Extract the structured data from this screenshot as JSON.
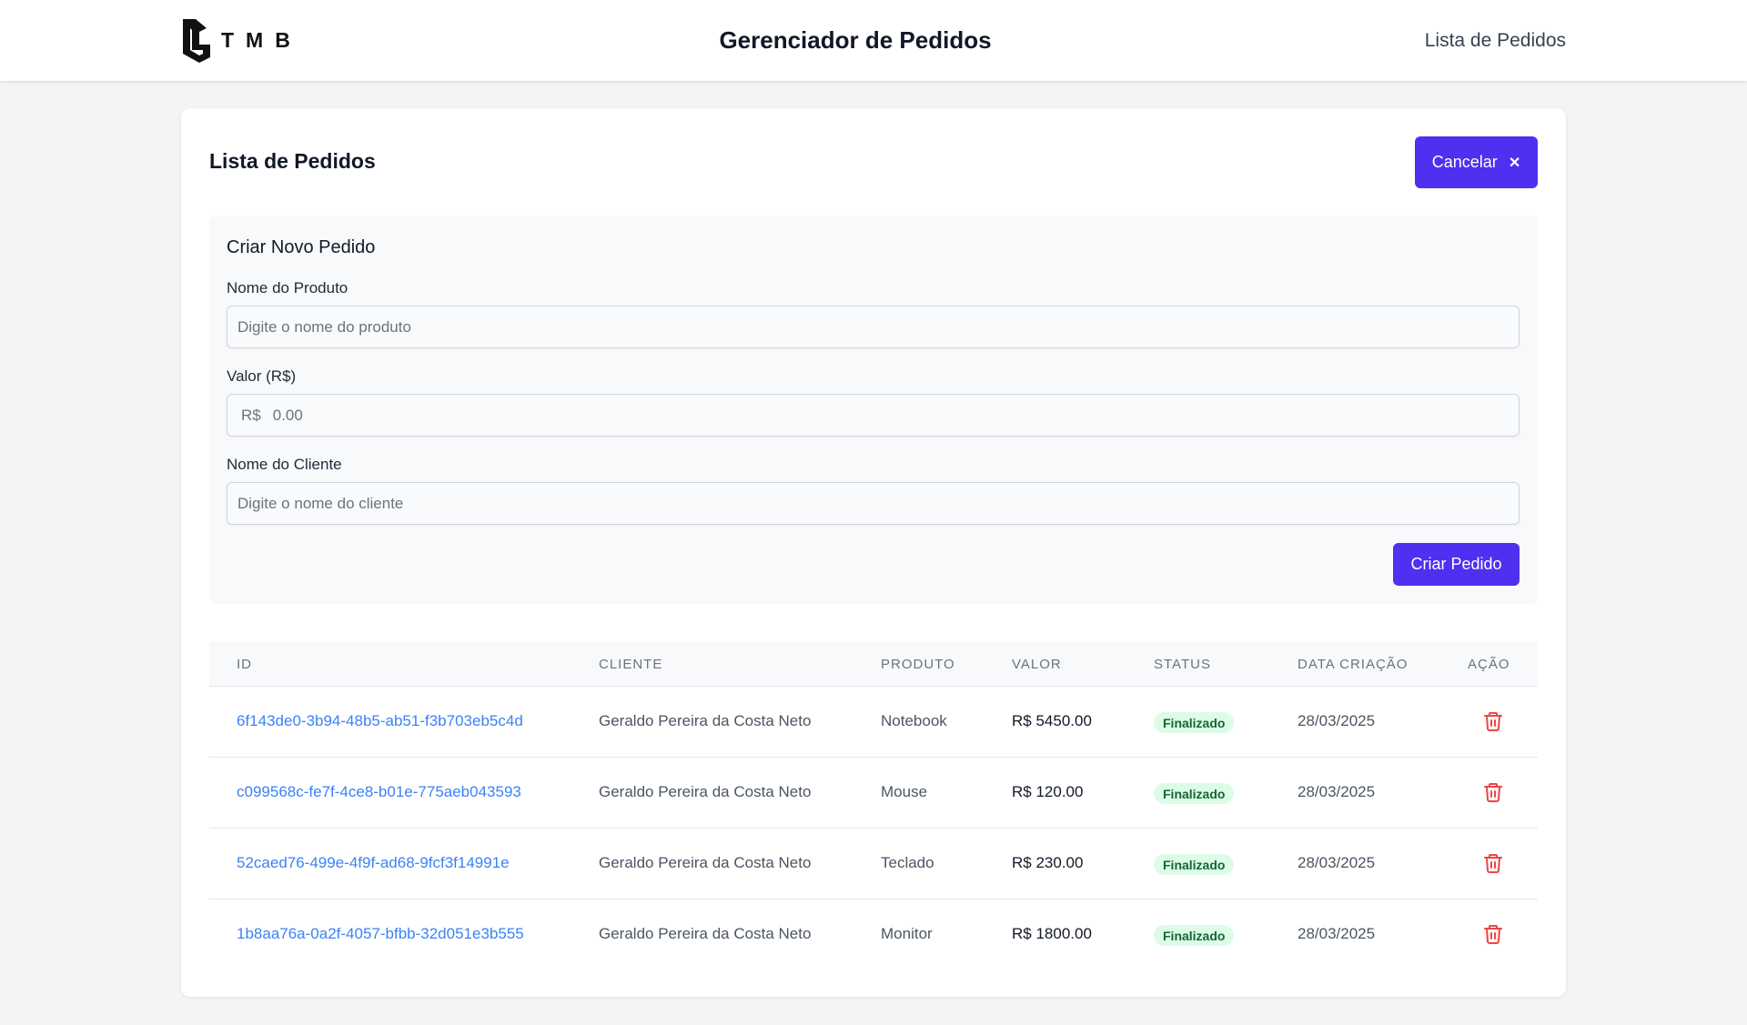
{
  "header": {
    "logo_text": "TMB",
    "title": "Gerenciador de Pedidos",
    "nav_link": "Lista de Pedidos"
  },
  "card": {
    "title": "Lista de Pedidos",
    "cancel_label": "Cancelar",
    "cancel_icon": "close-icon"
  },
  "form": {
    "heading": "Criar Novo Pedido",
    "product_label": "Nome do Produto",
    "product_placeholder": "Digite o nome do produto",
    "product_value": "",
    "value_label": "Valor (R$)",
    "value_prefix": "R$",
    "value_placeholder": "0.00",
    "value_value": "",
    "client_label": "Nome do Cliente",
    "client_placeholder": "Digite o nome do cliente",
    "client_value": "",
    "submit_label": "Criar Pedido"
  },
  "table": {
    "headers": {
      "id": "ID",
      "cliente": "CLIENTE",
      "produto": "PRODUTO",
      "valor": "VALOR",
      "status": "STATUS",
      "data": "DATA CRIAÇÃO",
      "acao": "AÇÃO"
    },
    "rows": [
      {
        "id": "6f143de0-3b94-48b5-ab51-f3b703eb5c4d",
        "cliente": "Geraldo Pereira da Costa Neto",
        "produto": "Notebook",
        "valor": "R$ 5450.00",
        "status": "Finalizado",
        "data": "28/03/2025"
      },
      {
        "id": "c099568c-fe7f-4ce8-b01e-775aeb043593",
        "cliente": "Geraldo Pereira da Costa Neto",
        "produto": "Mouse",
        "valor": "R$ 120.00",
        "status": "Finalizado",
        "data": "28/03/2025"
      },
      {
        "id": "52caed76-499e-4f9f-ad68-9fcf3f14991e",
        "cliente": "Geraldo Pereira da Costa Neto",
        "produto": "Teclado",
        "valor": "R$ 230.00",
        "status": "Finalizado",
        "data": "28/03/2025"
      },
      {
        "id": "1b8aa76a-0a2f-4057-bfbb-32d051e3b555",
        "cliente": "Geraldo Pereira da Costa Neto",
        "produto": "Monitor",
        "valor": "R$ 1800.00",
        "status": "Finalizado",
        "data": "28/03/2025"
      }
    ],
    "action_icon": "trash-icon"
  },
  "colors": {
    "accent": "#4f2ff0",
    "link": "#3b82f6",
    "status_bg": "#dcfce7",
    "status_text": "#166534",
    "danger": "#ef4444"
  }
}
